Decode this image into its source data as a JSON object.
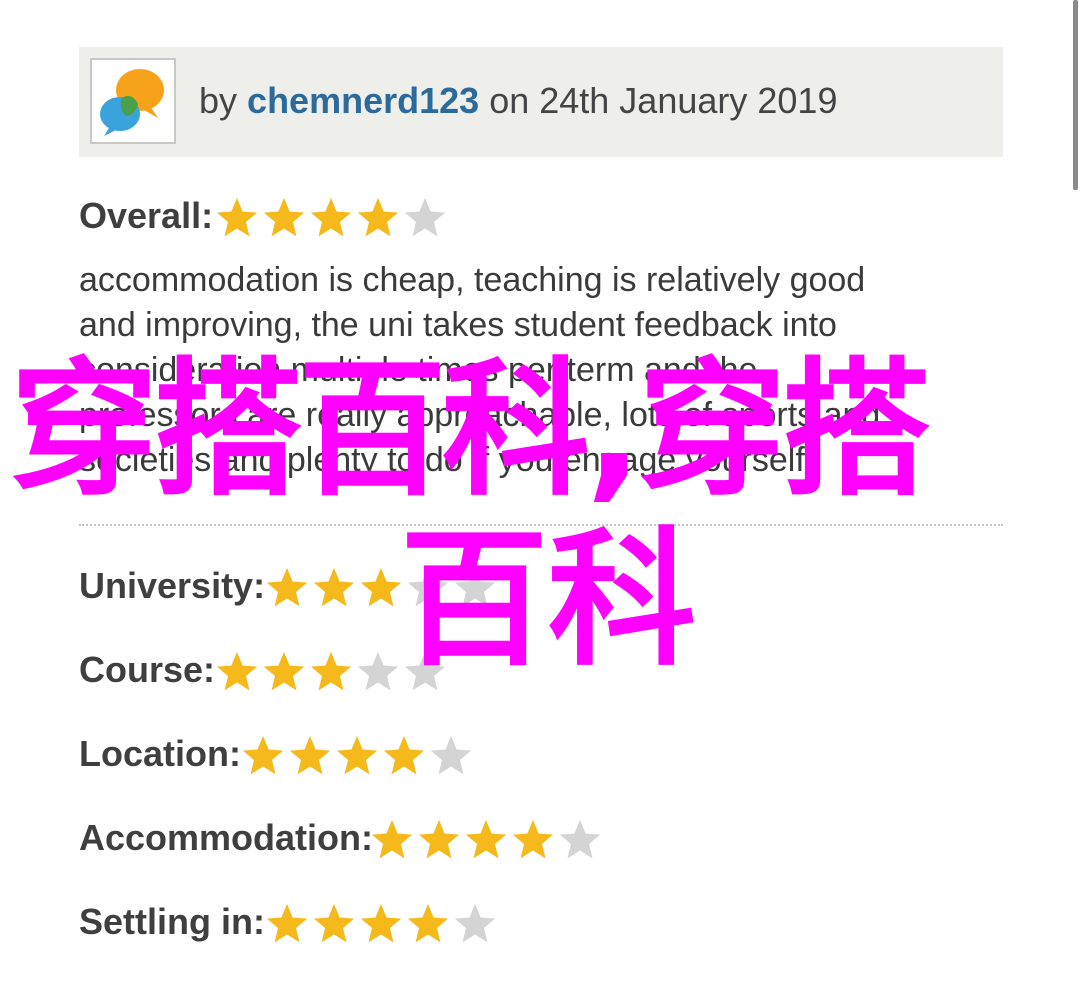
{
  "review": {
    "by_prefix": "by",
    "author": "chemnerd123",
    "date_text": "on 24th January 2019",
    "avatar_icon": "speech-bubbles-icon",
    "overall": {
      "label": "Overall:",
      "rating": 4,
      "max": 5
    },
    "text_lines": [
      "accommodation is cheap, teaching is relatively good",
      "and improving, the uni takes student feedback into",
      "consideration multiple times per term and the",
      "professors are really approachable, lots of sports and",
      "societies and plenty to do if you engage yourself"
    ],
    "categories": [
      {
        "label": "University:",
        "rating": 3,
        "max": 5
      },
      {
        "label": "Course:",
        "rating": 3,
        "max": 5
      },
      {
        "label": "Location:",
        "rating": 4,
        "max": 5
      },
      {
        "label": "Accommodation:",
        "rating": 4,
        "max": 5
      },
      {
        "label": "Settling in:",
        "rating": 4,
        "max": 5
      }
    ]
  },
  "watermark": {
    "line1": "穿搭百科,穿搭",
    "line2": "百科",
    "color": "#ff00ff"
  },
  "colors": {
    "star_filled": "#f6b91c",
    "star_empty": "#d4d4d4",
    "author": "#2b6a9b",
    "header_bg": "#eeeeea"
  }
}
